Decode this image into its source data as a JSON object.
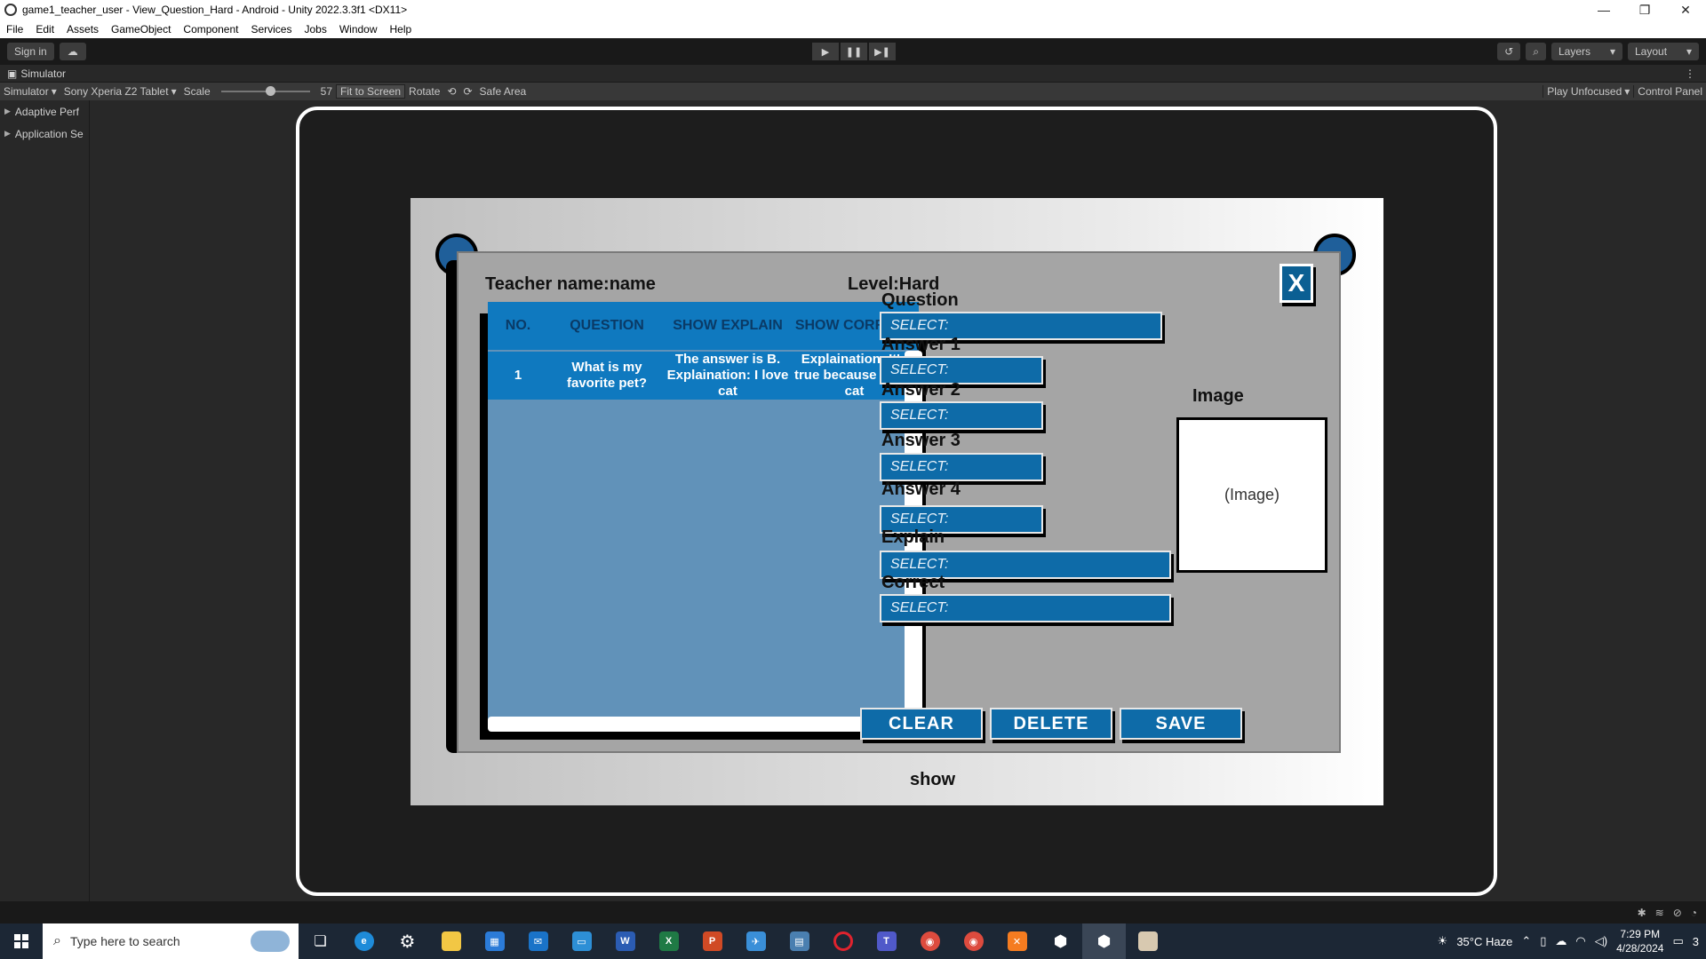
{
  "window": {
    "title": "game1_teacher_user - View_Question_Hard - Android - Unity 2022.3.3f1 <DX11>",
    "controls": [
      "—",
      "❐",
      "✕"
    ]
  },
  "menu": [
    "File",
    "Edit",
    "Assets",
    "GameObject",
    "Component",
    "Services",
    "Jobs",
    "Window",
    "Help"
  ],
  "toolbar": {
    "sign_in": "Sign in",
    "layers": "Layers",
    "layout": "Layout"
  },
  "simulator": {
    "tab_label": "Simulator",
    "mode": "Simulator",
    "device": "Sony Xperia Z2 Tablet",
    "scale_label": "Scale",
    "scale_value": "57",
    "fit_to_screen": "Fit to Screen",
    "rotate": "Rotate",
    "safe_area": "Safe Area",
    "play_mode": "Play Unfocused",
    "control_panel": "Control Panel"
  },
  "left_panel": [
    "Adaptive Perf",
    "Application Se"
  ],
  "game": {
    "teacher_label": "Teacher name:name",
    "level_label": "Level:Hard",
    "close": "X",
    "table": {
      "headers": [
        "NO.",
        "QUESTION",
        "SHOW EXPLAIN",
        "SHOW CORRECT"
      ],
      "rows": [
        [
          "1",
          "What is my favorite pet?",
          "The answer is B. Explaination: I love cat",
          "Explaination: It's true because i love cat"
        ]
      ]
    },
    "form": {
      "question_label": "Question",
      "answer1_label": "Answer 1",
      "answer2_label": "Answer 2",
      "answer3_label": "Answer 3",
      "answer4_label": "Answer 4",
      "explain_label": "Explain",
      "correct_label": "Correct",
      "placeholder": "SELECT:"
    },
    "image_title": "Image",
    "image_placeholder": "(Image)",
    "buttons": {
      "clear": "CLEAR",
      "delete": "DELETE",
      "save": "SAVE"
    },
    "show": "show"
  },
  "taskbar": {
    "search_placeholder": "Type here to search",
    "weather": "35°C  Haze",
    "time": "7:29 PM",
    "date": "4/28/2024",
    "notifications": "3"
  },
  "colors": {
    "button_blue": "#0e6ba8",
    "table_header": "#0f79bf",
    "table_body": "#6192b9",
    "panel_gray": "#a5a5a5"
  }
}
